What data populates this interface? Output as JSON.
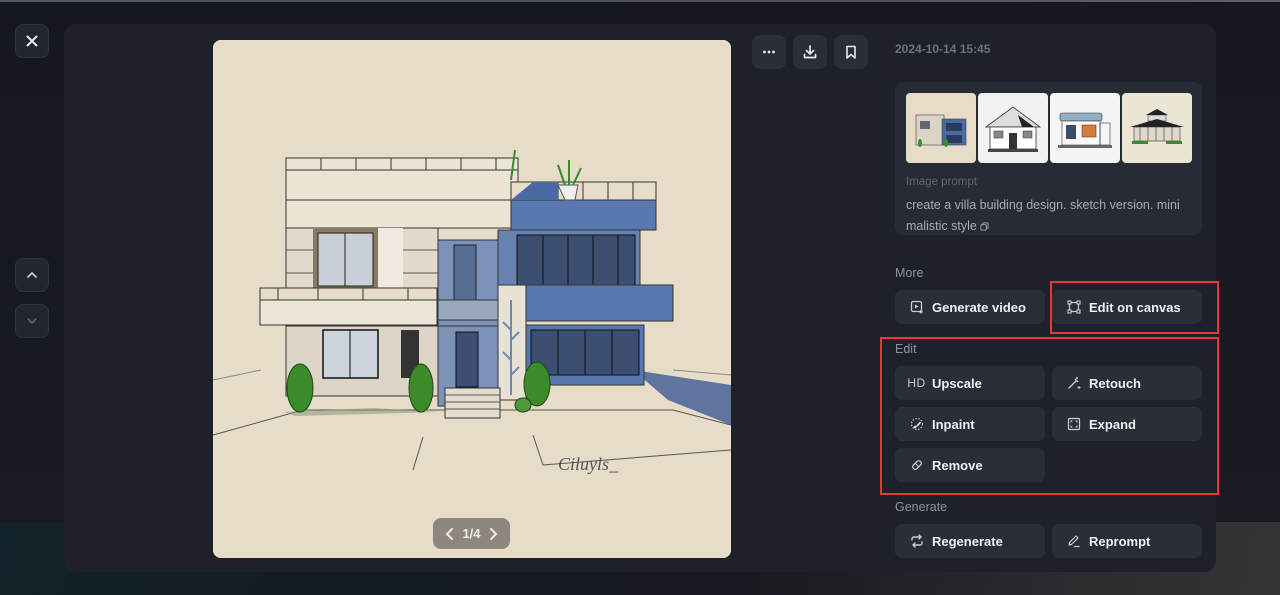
{
  "window": {
    "close_icon": "close-icon",
    "nav_up_icon": "chevron-up-icon",
    "nav_down_icon": "chevron-down-icon"
  },
  "viewer": {
    "image_alt": "Sketch of a modern two-storey villa with blue and beige facades, shrubs and a signature",
    "signature": "Ciluyls_",
    "pager": {
      "current": 1,
      "total": 4,
      "label": "1/4",
      "prev_icon": "chevron-left-icon",
      "next_icon": "chevron-right-icon"
    }
  },
  "toolbar": {
    "more_icon": "more-horizontal-icon",
    "download_icon": "download-icon",
    "bookmark_icon": "bookmark-icon"
  },
  "details": {
    "timestamp": "2024-10-14 15:45",
    "thumbnails": [
      {
        "name": "villa-blue-beige",
        "selected": true
      },
      {
        "name": "house-white-gable",
        "selected": false
      },
      {
        "name": "house-blue-roof",
        "selected": false
      },
      {
        "name": "house-pagoda-roof",
        "selected": false
      }
    ],
    "prompt_label": "Image prompt",
    "prompt_text": "create a villa building design. sketch version. mini malistic style",
    "copy_icon": "copy-icon"
  },
  "sections": {
    "more": {
      "label": "More",
      "buttons": [
        {
          "label": "Generate video",
          "icon": "video-plus-icon"
        },
        {
          "label": "Edit on canvas",
          "icon": "canvas-frame-icon"
        }
      ]
    },
    "edit": {
      "label": "Edit",
      "buttons": [
        {
          "label": "Upscale",
          "icon": "hd-icon",
          "icon_text": "HD"
        },
        {
          "label": "Retouch",
          "icon": "magic-wand-icon"
        },
        {
          "label": "Inpaint",
          "icon": "brush-selection-icon"
        },
        {
          "label": "Expand",
          "icon": "expand-frame-icon"
        },
        {
          "label": "Remove",
          "icon": "eraser-icon"
        }
      ]
    },
    "generate": {
      "label": "Generate",
      "buttons": [
        {
          "label": "Regenerate",
          "icon": "repeat-icon"
        },
        {
          "label": "Reprompt",
          "icon": "pencil-icon"
        }
      ]
    }
  },
  "annotations": {
    "highlight_color": "#e53935",
    "highlighted": [
      "Edit on canvas",
      "Edit section"
    ]
  },
  "colors": {
    "modal_bg": "#1e212a",
    "button_bg": "#2a2e37",
    "image_bg": "#e6dcc8",
    "accent_highlight": "#e53935"
  }
}
